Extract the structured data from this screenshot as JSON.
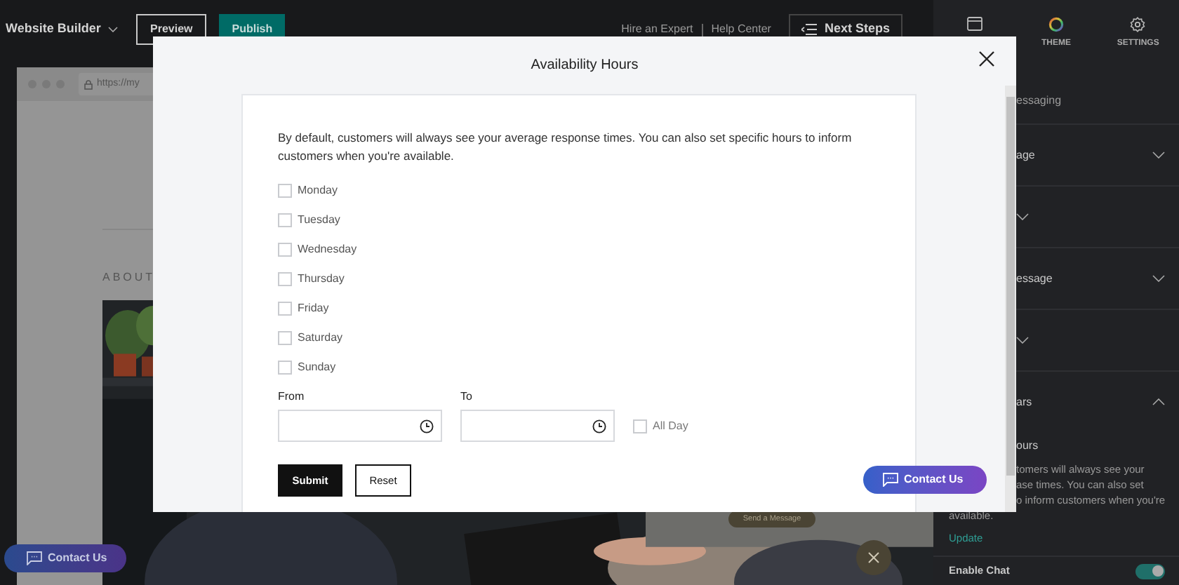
{
  "top_bar": {
    "menu": "Website Builder",
    "buttons": [
      {
        "label": "Preview",
        "kind": "outline"
      },
      {
        "label": "Publish",
        "kind": "primary"
      }
    ],
    "links": [
      "Hire an Expert",
      "Help Center"
    ],
    "next_steps": "Next Steps"
  },
  "preview": {
    "url": "https://my",
    "section_heading": "ABOUT",
    "send_message": "Send a Message",
    "contact_button": "Contact Us"
  },
  "side_panel": {
    "tabs": [
      {
        "kind": "layout"
      },
      {
        "kind": "theme",
        "label": "THEME"
      },
      {
        "kind": "settings",
        "label": "SETTINGS"
      }
    ],
    "intro": "essaging",
    "sections": [
      {
        "title": "age",
        "expanded": false
      },
      {
        "expanded": false
      },
      {
        "title": "essage",
        "expanded": false
      },
      {
        "expanded": false
      },
      {
        "title": "ars",
        "expanded": true,
        "subtitle": "ours",
        "lines": [
          "tomers will always see your",
          "ase times. You can also set",
          "o inform customers when you're"
        ],
        "last_line": "available.",
        "link": "Update"
      }
    ],
    "enable_chat": {
      "label": "Enable Chat",
      "on": true
    }
  },
  "modal": {
    "title": "Availability Hours",
    "intro": "By default, customers will always see your average response times. You can also set specific hours to inform customers when you're available.",
    "days": [
      {
        "label": "Monday",
        "checked": false
      },
      {
        "label": "Tuesday",
        "checked": false
      },
      {
        "label": "Wednesday",
        "checked": false
      },
      {
        "label": "Thursday",
        "checked": false
      },
      {
        "label": "Friday",
        "checked": false
      },
      {
        "label": "Saturday",
        "checked": false
      },
      {
        "label": "Sunday",
        "checked": false
      }
    ],
    "from": {
      "label": "From"
    },
    "to": {
      "label": "To"
    },
    "all_day": {
      "label": "All Day",
      "checked": false
    },
    "buttons": [
      {
        "label": "Submit",
        "kind": "primary"
      },
      {
        "label": "Reset",
        "kind": "outline"
      }
    ],
    "contact_button": "Contact Us"
  }
}
